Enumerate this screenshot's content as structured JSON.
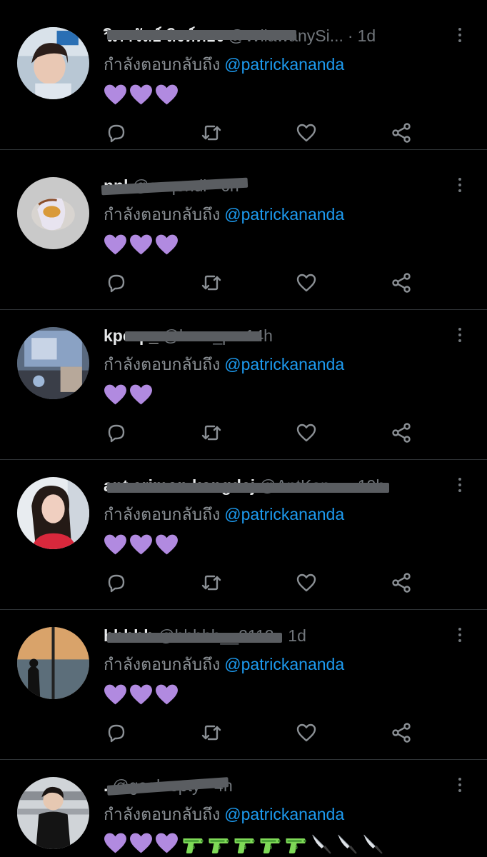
{
  "colors": {
    "background": "#000000",
    "divider": "#2f3336",
    "secondary_text": "#71767b",
    "mention": "#1d9bf0",
    "heart_purple": "#b18ae0",
    "icon_gray": "#8b9095"
  },
  "icons": {
    "reply": "speech-bubble-icon",
    "retweet": "retweet-arrows-icon",
    "like": "heart-outline-icon",
    "share": "share-nodes-icon",
    "more": "vertical-ellipsis-icon"
  },
  "tweets": [
    {
      "name": "วิภาวัลย์ สิงห์ทอง",
      "handle": "@WilawanySi...",
      "time": "1d",
      "replying_prefix": "กำลังตอบกลับถึง",
      "replying_to": "@patrickananda",
      "emojis": [
        "purple-heart",
        "purple-heart",
        "purple-heart"
      ]
    },
    {
      "name": "nnl",
      "handle": "@snqendi",
      "time": "6h",
      "replying_prefix": "กำลังตอบกลับถึง",
      "replying_to": "@patrickananda",
      "emojis": [
        "purple-heart",
        "purple-heart",
        "purple-heart"
      ]
    },
    {
      "name": "kporp_",
      "handle": "@kaxx_p",
      "time": "14h",
      "replying_prefix": "กำลังตอบกลับถึง",
      "replying_to": "@patrickananda",
      "emojis": [
        "purple-heart",
        "purple-heart"
      ]
    },
    {
      "name": "ant srimon kongdej",
      "handle": "@AntKon...",
      "time": "19h",
      "replying_prefix": "กำลังตอบกลับถึง",
      "replying_to": "@patrickananda",
      "emojis": [
        "purple-heart",
        "purple-heart",
        "purple-heart"
      ]
    },
    {
      "name": "hhhhh",
      "handle": "@hhhhh__2112",
      "time": "1d",
      "replying_prefix": "กำลังตอบกลับถึง",
      "replying_to": "@patrickananda",
      "emojis": [
        "purple-heart",
        "purple-heart",
        "purple-heart"
      ]
    },
    {
      "name": ".",
      "handle": "@goolnepty",
      "time": "4h",
      "replying_prefix": "กำลังตอบกลับถึง",
      "replying_to": "@patrickananda",
      "emojis": [
        "purple-heart",
        "purple-heart",
        "purple-heart",
        "water-pistol",
        "water-pistol",
        "water-pistol",
        "water-pistol",
        "water-pistol",
        "kitchen-knife",
        "kitchen-knife",
        "kitchen-knife"
      ]
    }
  ]
}
